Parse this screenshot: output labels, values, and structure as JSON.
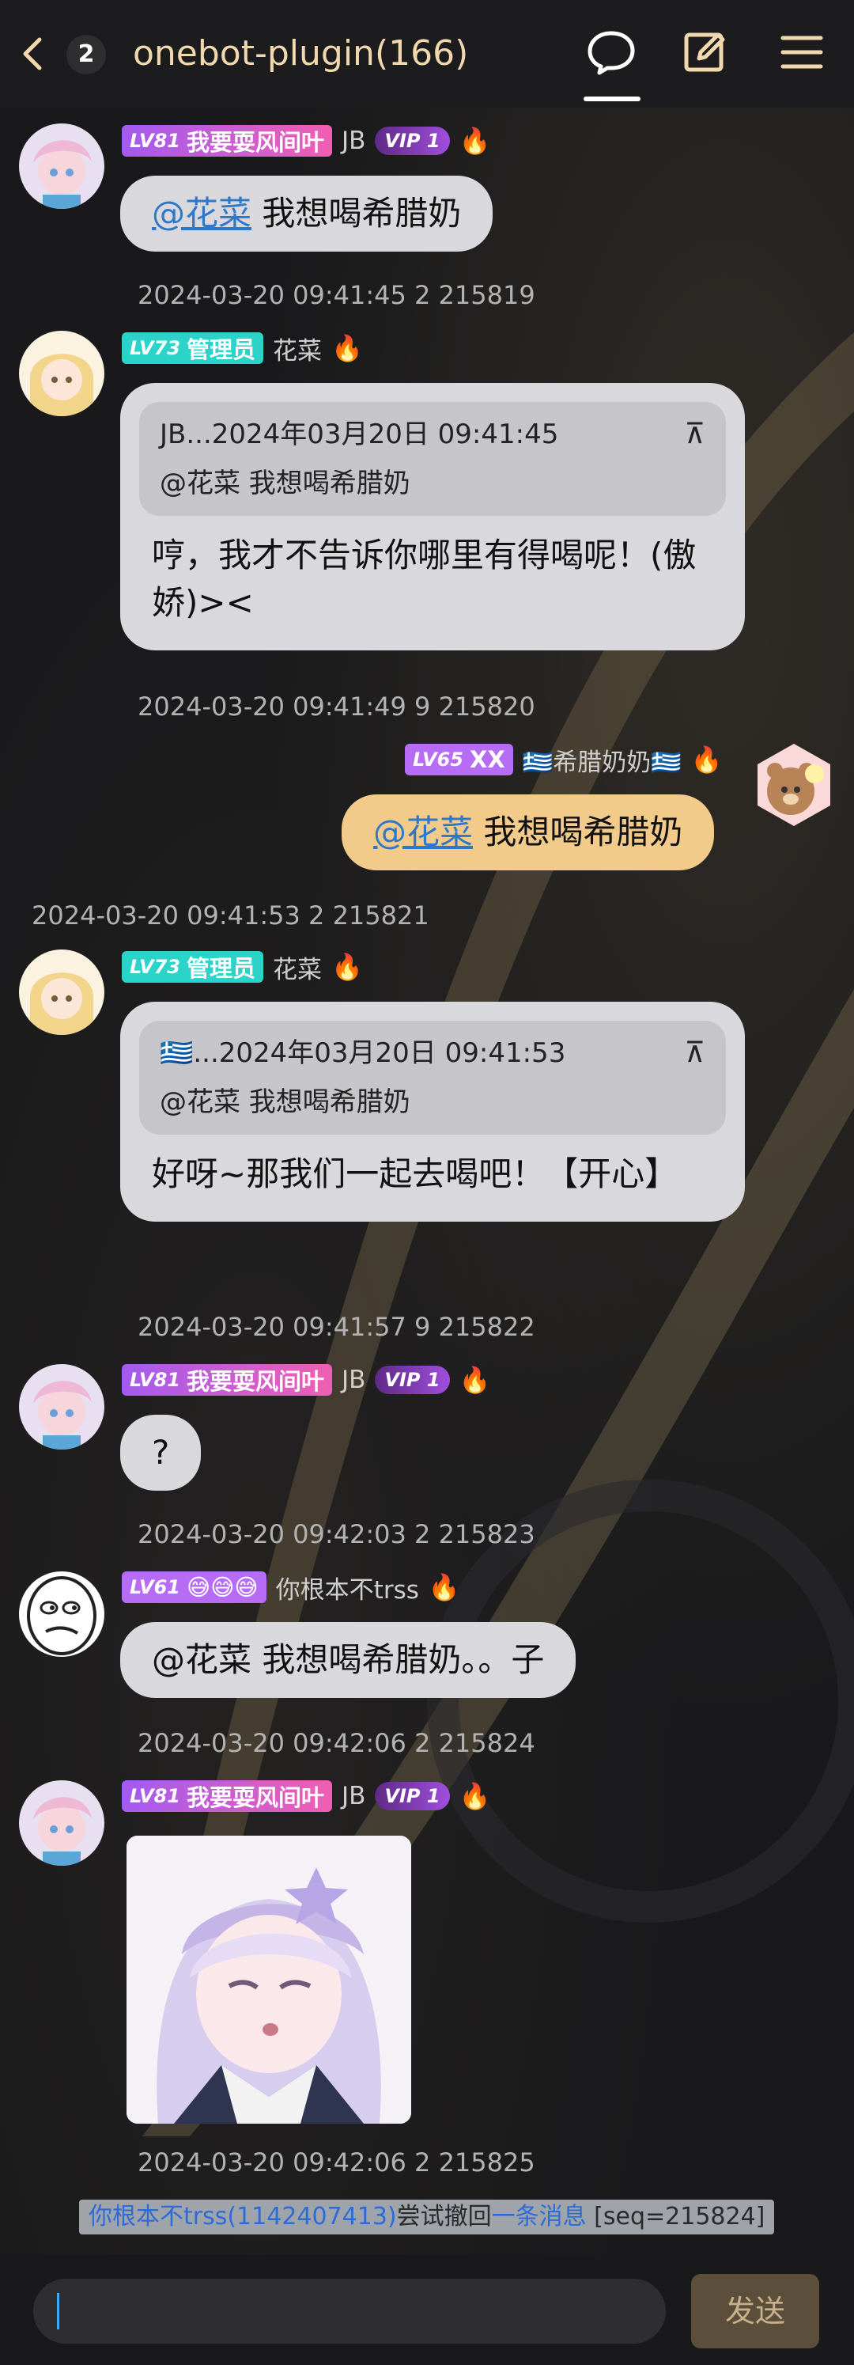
{
  "header": {
    "unread_count": "2",
    "title": "onebot-plugin(166)"
  },
  "messages": [
    {
      "level": "LV81",
      "title_tag": "我要耍风间叶",
      "nick": "JB",
      "vip": "VIP 1",
      "at": "@花菜",
      "text": "我想喝希腊奶",
      "timestamp": "2024-03-20 09:41:45 2 215819"
    },
    {
      "level": "LV73",
      "title_tag": "管理员",
      "nick": "花菜",
      "quote_header": "JB...2024年03月20日 09:41:45",
      "quote_text": "@花菜 我想喝希腊奶",
      "text": "哼，我才不告诉你哪里有得喝呢！(傲娇)><",
      "timestamp": "2024-03-20 09:41:49 9 215820"
    },
    {
      "level": "LV65",
      "title_tag": "XX",
      "nick": "🇬🇷希腊奶奶🇬🇷",
      "at": "@花菜",
      "text": "我想喝希腊奶",
      "timestamp": "2024-03-20 09:41:53 2 215821"
    },
    {
      "level": "LV73",
      "title_tag": "管理员",
      "nick": "花菜",
      "quote_header": "🇬🇷...2024年03月20日 09:41:53",
      "quote_text": "@花菜 我想喝希腊奶",
      "text": "好呀~那我们一起去喝吧！【开心】",
      "timestamp": "2024-03-20 09:41:57 9 215822"
    },
    {
      "level": "LV81",
      "title_tag": "我要耍风间叶",
      "nick": "JB",
      "vip": "VIP 1",
      "text": "?",
      "timestamp": "2024-03-20 09:42:03 2 215823"
    },
    {
      "level": "LV61",
      "title_tag": "😅😅😅",
      "nick": "你根本不trss",
      "text": "@花菜 我想喝希腊奶。。子",
      "timestamp": "2024-03-20 09:42:06 2 215824"
    },
    {
      "level": "LV81",
      "title_tag": "我要耍风间叶",
      "nick": "JB",
      "vip": "VIP 1",
      "timestamp": "2024-03-20 09:42:06 2 215825"
    }
  ],
  "notice": {
    "user": "你根本不trss(1142407413)",
    "action": "尝试撤回",
    "link": "一条消息",
    "seq": " [seq=215824]"
  },
  "input": {
    "value": "",
    "send_label": "发送"
  },
  "icons": {
    "back": "chevron-left-icon",
    "chat": "chat-bubble-icon",
    "edit": "edit-icon",
    "menu": "menu-icon",
    "pin": "pin-top-icon",
    "fire": "fire-icon"
  },
  "colors": {
    "title": "#f1d8ad",
    "bubble_other": "#d9d8dc",
    "bubble_me": "#f2cb8b",
    "mention": "#2d78c9",
    "admin_tag": "#2bd3c8"
  }
}
